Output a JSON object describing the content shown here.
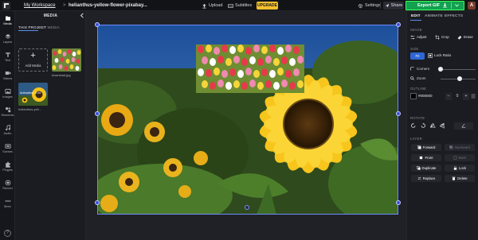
{
  "topbar": {
    "workspace": "My Workspace",
    "separator": ">",
    "filename": "helianthus-yellow-flower-pixabay...",
    "upload": "Upload",
    "subtitles": "Subtitles",
    "upgrade": "UPGRADE",
    "settings": "Settings",
    "share": "Share",
    "export": "Export GIF",
    "avatar": "A"
  },
  "rail": {
    "items": [
      {
        "label": "Media",
        "icon": "media-icon"
      },
      {
        "label": "Layers",
        "icon": "layers-icon"
      },
      {
        "label": "Text",
        "icon": "text-icon"
      },
      {
        "label": "Videos",
        "icon": "video-icon"
      },
      {
        "label": "Images",
        "icon": "image-icon"
      },
      {
        "label": "Elements",
        "icon": "elements-icon"
      },
      {
        "label": "Audio",
        "icon": "audio-icon"
      },
      {
        "label": "Scenes",
        "icon": "scenes-icon"
      },
      {
        "label": "Plugins",
        "icon": "plugins-icon"
      },
      {
        "label": "Record",
        "icon": "record-icon"
      },
      {
        "label": "More",
        "icon": "more-icon"
      }
    ],
    "help": "?"
  },
  "media": {
    "title": "MEDIA",
    "tab_project": "THIS PROJECT",
    "tab_my_media": "MY MEDIA",
    "add_media": "Add Media",
    "items": [
      {
        "caption": "download.jpg",
        "tag": ""
      },
      {
        "caption": "helianthus-yell...",
        "tag": "Animation, 0:06"
      }
    ]
  },
  "rightpanel": {
    "tabs": {
      "edit": "EDIT",
      "animate": "ANIMATE",
      "effects": "EFFECTS"
    },
    "image_label": "IMAGE",
    "adjust": "Adjust",
    "crop": "Crop",
    "erase": "Erase",
    "size_label": "SIZE",
    "fit": "Fit",
    "lock_ratio": "Lock Ratio",
    "corners": "Corners",
    "zoom": "Zoom",
    "corners_value": 0.0,
    "zoom_value": 0.55,
    "outline_label": "OUTLINE",
    "outline_color": "#000000",
    "outline_width": "0",
    "rotate_label": "ROTATE",
    "layer_label": "LAYER",
    "forward": "Forward",
    "backward": "Backward",
    "front": "Front",
    "back": "Back",
    "duplicate": "Duplicate",
    "lock": "Lock",
    "replace": "Replace",
    "delete": "Delete"
  },
  "colors": {
    "accent": "#2e66d6",
    "export_green": "#11a14f",
    "upgrade_yellow": "#f5c02e",
    "selection": "#3b4fe0"
  }
}
